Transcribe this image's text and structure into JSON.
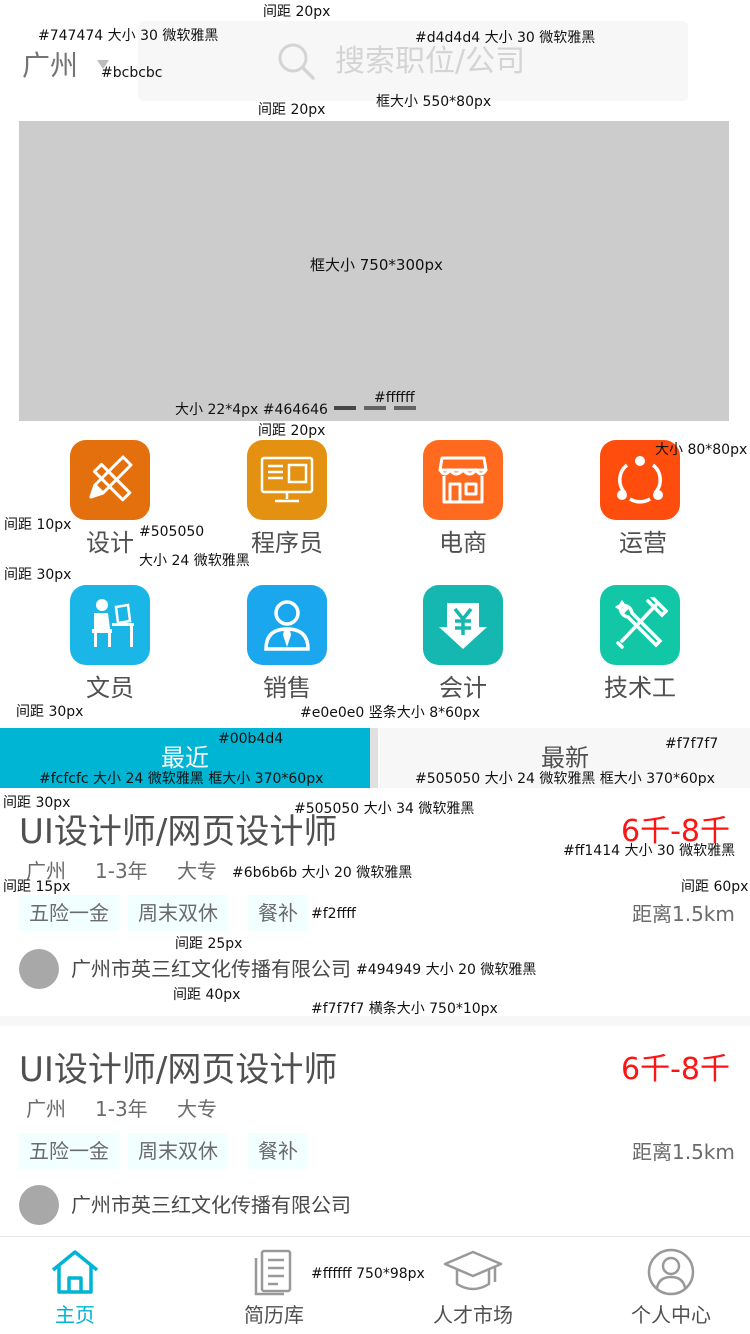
{
  "header": {
    "city": "广州",
    "search_placeholder": "搜索职位/公司"
  },
  "banner": {
    "label": "框大小    750*300px"
  },
  "categories": [
    {
      "label": "设计",
      "icon": "pencil-ruler-icon",
      "color": "#e3700d"
    },
    {
      "label": "程序员",
      "icon": "monitor-code-icon",
      "color": "#e49010"
    },
    {
      "label": "电商",
      "icon": "storefront-icon",
      "color": "#ff6a1e"
    },
    {
      "label": "运营",
      "icon": "cycle-nodes-icon",
      "color": "#ff4d0e"
    },
    {
      "label": "文员",
      "icon": "clerk-desk-icon",
      "color": "#1ab6e8"
    },
    {
      "label": "销售",
      "icon": "salesperson-icon",
      "color": "#1ba7ee"
    },
    {
      "label": "会计",
      "icon": "yen-download-icon",
      "color": "#15b8b0"
    },
    {
      "label": "技术工",
      "icon": "wrench-hammer-icon",
      "color": "#12c7a6"
    }
  ],
  "tabs": [
    {
      "label": "最近",
      "active": true
    },
    {
      "label": "最新",
      "active": false
    }
  ],
  "jobs": [
    {
      "title": "UI设计师/网页设计师",
      "salary": "6千-8千",
      "city": "广州",
      "experience": "1-3年",
      "education": "大专",
      "tags": [
        "五险一金",
        "周末双休",
        "餐补"
      ],
      "distance": "距离1.5km",
      "company": "广州市英三红文化传播有限公司"
    },
    {
      "title": "UI设计师/网页设计师",
      "salary": "6千-8千",
      "city": "广州",
      "experience": "1-3年",
      "education": "大专",
      "tags": [
        "五险一金",
        "周末双休",
        "餐补"
      ],
      "distance": "距离1.5km",
      "company": "广州市英三红文化传播有限公司"
    }
  ],
  "bottom_nav": [
    {
      "label": "主页",
      "icon": "home-icon",
      "active": true
    },
    {
      "label": "简历库",
      "icon": "resume-icon",
      "active": false
    },
    {
      "label": "人才市场",
      "icon": "graduation-cap-icon",
      "active": false
    },
    {
      "label": "个人中心",
      "icon": "user-circle-icon",
      "active": false
    }
  ],
  "colors": {
    "accent": "#00b4d4",
    "salary": "#ff1414",
    "banner_dot_active": "#464646",
    "banner_dot": "#ffffff"
  },
  "annotations": {
    "a01": "#747474  大小 30  微软雅黑",
    "a02": "间距 20px",
    "a03": "#d4d4d4  大小 30  微软雅黑",
    "a04": "#bcbcbc",
    "a05": "间距 20px",
    "a06": "框大小  550*80px",
    "a07": "大小 22*4px #464646",
    "a08": "#ffffff",
    "a09": "间距 20px",
    "a10": "大小 80*80px",
    "a11": "间距 10px",
    "a12": "#505050",
    "a13": "大小 24  微软雅黑",
    "a14": "间距 30px",
    "a15": "间距 30px",
    "a16": "#e0e0e0  竖条大小 8*60px",
    "a17": "#00b4d4",
    "a18": "#f7f7f7",
    "a19": "#fcfcfc 大小 24  微软雅黑   框大小 370*60px",
    "a20": "#505050 大小 24  微软雅黑   框大小 370*60px",
    "a21": "间距 30px",
    "a22": "#505050  大小 34  微软雅黑",
    "a23": "#ff1414 大小 30  微软雅黑",
    "a24": "间距 15px",
    "a25": "#6b6b6b  大小 20  微软雅黑",
    "a26": "间距 60px",
    "a27": "#f2ffff",
    "a28": "间距 25px",
    "a29": "#494949  大小 20  微软雅黑",
    "a30": "间距 40px",
    "a31": "#f7f7f7  横条大小 750*10px",
    "a32": "#ffffff  750*98px"
  }
}
